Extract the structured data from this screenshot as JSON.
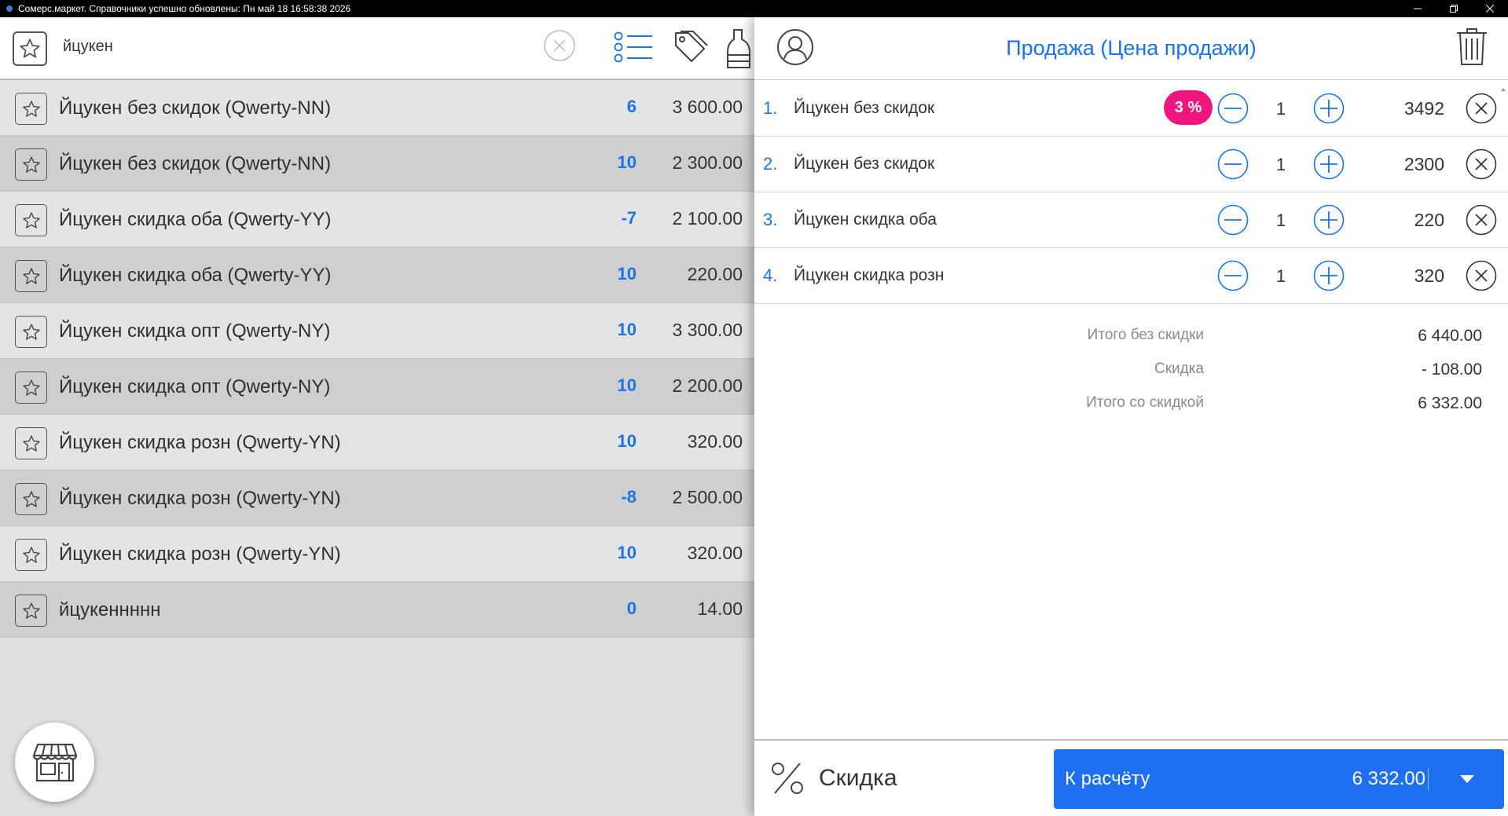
{
  "titlebar": {
    "text": "Сомерс.маркет. Справочники успешно обновлены: Пн май 18 16:58:38 2026"
  },
  "search": {
    "query": "йцукен"
  },
  "products": [
    {
      "name": "Йцукен без скидок (Qwerty-NN)",
      "qty": "6",
      "price": "3 600.00"
    },
    {
      "name": "Йцукен без скидок (Qwerty-NN)",
      "qty": "10",
      "price": "2 300.00"
    },
    {
      "name": "Йцукен скидка оба (Qwerty-YY)",
      "qty": "-7",
      "price": "2 100.00"
    },
    {
      "name": "Йцукен скидка оба (Qwerty-YY)",
      "qty": "10",
      "price": "220.00"
    },
    {
      "name": "Йцукен скидка опт (Qwerty-NY)",
      "qty": "10",
      "price": "3 300.00"
    },
    {
      "name": "Йцукен скидка опт (Qwerty-NY)",
      "qty": "10",
      "price": "2 200.00"
    },
    {
      "name": "Йцукен скидка розн (Qwerty-YN)",
      "qty": "10",
      "price": "320.00"
    },
    {
      "name": "Йцукен скидка розн (Qwerty-YN)",
      "qty": "-8",
      "price": "2 500.00"
    },
    {
      "name": "Йцукен скидка розн (Qwerty-YN)",
      "qty": "10",
      "price": "320.00"
    },
    {
      "name": "йцукеннннн",
      "qty": "0",
      "price": "14.00"
    }
  ],
  "sale": {
    "title": "Продажа (Цена продажи)",
    "items": [
      {
        "num": "1.",
        "name": "Йцукен без скидок",
        "badge": "3 %",
        "qty": "1",
        "sum": "3492"
      },
      {
        "num": "2.",
        "name": "Йцукен без скидок",
        "qty": "1",
        "sum": "2300"
      },
      {
        "num": "3.",
        "name": "Йцукен скидка оба",
        "qty": "1",
        "sum": "220"
      },
      {
        "num": "4.",
        "name": "Йцукен скидка розн",
        "qty": "1",
        "sum": "320"
      }
    ],
    "totals": {
      "subtotal_label": "Итого без скидки",
      "subtotal_value": "6 440.00",
      "discount_label": "Скидка",
      "discount_value": "- 108.00",
      "total_label": "Итого со скидкой",
      "total_value": "6 332.00"
    }
  },
  "footer": {
    "discount_label": "Скидка",
    "pay_label": "К расчёту",
    "pay_amount": "6 332.00"
  },
  "colors": {
    "accent": "#1a73e8",
    "badge": "#f0157f",
    "pay_button": "#1f6ff2"
  }
}
